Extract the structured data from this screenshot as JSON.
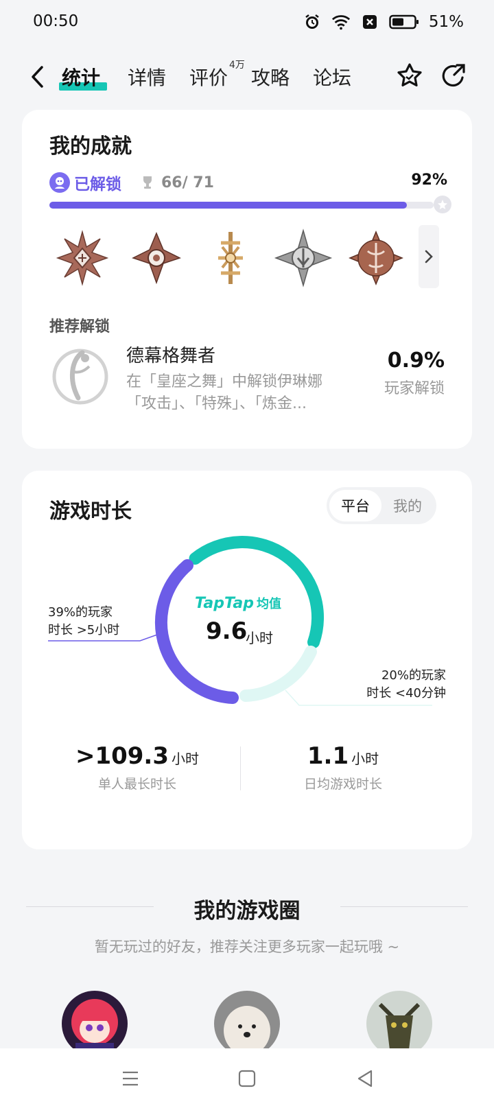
{
  "status_bar": {
    "time": "00:50",
    "battery": "51%"
  },
  "nav": {
    "tabs": [
      {
        "label": "统计"
      },
      {
        "label": "详情"
      },
      {
        "label": "评价"
      },
      {
        "label": "攻略"
      },
      {
        "label": "论坛"
      }
    ],
    "review_badge": "4万",
    "active_tab_index": 0
  },
  "achievements": {
    "title": "我的成就",
    "unlocked_label": "已解锁",
    "count": "66/ 71",
    "percent_label": "92%",
    "progress": 0.93,
    "badges": [
      "achievement-badge-1",
      "achievement-badge-2",
      "achievement-badge-3",
      "achievement-badge-4",
      "achievement-badge-5"
    ],
    "recommend_label": "推荐解锁",
    "recommend": {
      "name": "德幕格舞者",
      "desc_line1": "在「皇座之舞」中解锁伊琳娜",
      "desc_line2": "「攻击」、「特殊」、「炼金...",
      "percent": "0.9%",
      "percent_label": "玩家解锁"
    }
  },
  "playtime": {
    "title": "游戏时长",
    "segment": {
      "on": "平台",
      "off": "我的"
    },
    "center_brand": "TapTap",
    "center_brand_suffix": "均值",
    "center_value": "9.6",
    "center_unit": "小时",
    "left_label_1": "39%的玩家",
    "left_label_2": "时长 >5小时",
    "right_label_1": "20%的玩家",
    "right_label_2": "时长 <40分钟",
    "stats": [
      {
        "value": ">109.3",
        "unit": "小时",
        "label": "单人最长时长"
      },
      {
        "value": "1.1",
        "unit": "小时",
        "label": "日均游戏时长"
      }
    ],
    "colors": {
      "teal": "#16c6b5",
      "purple": "#6c5ce7",
      "light_teal": "#dff7f4"
    }
  },
  "game_circle": {
    "title": "我的游戏圈",
    "subtitle": "暂无玩过的好友，推荐关注更多玩家一起玩哦 ~",
    "friends": [
      "friend-avatar-1",
      "friend-avatar-2",
      "friend-avatar-3"
    ]
  }
}
